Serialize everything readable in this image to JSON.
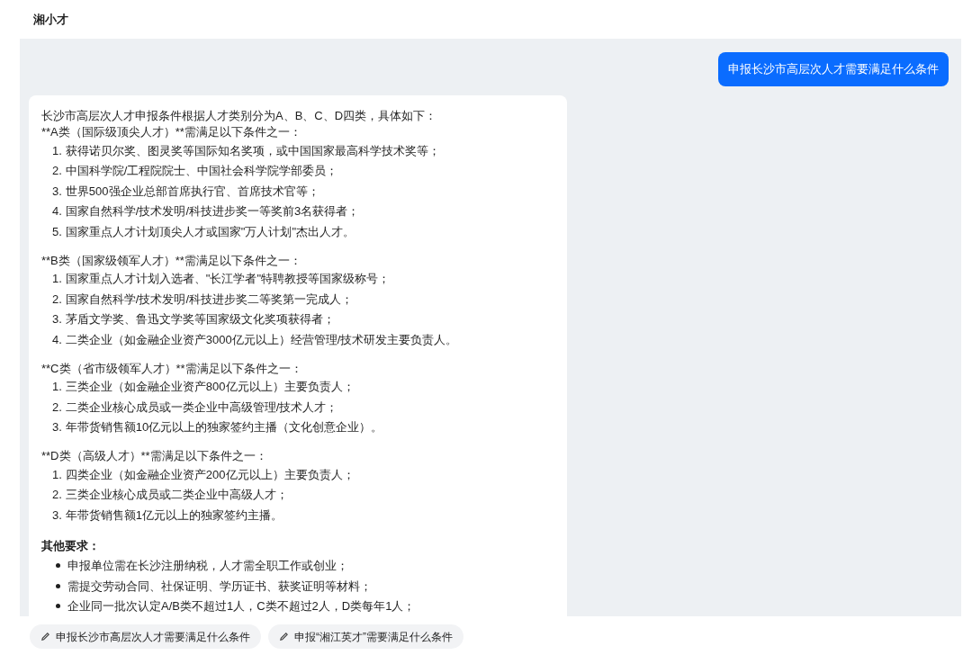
{
  "app_title": "湘小才",
  "user_message": "申报长沙市高层次人才需要满足什么条件",
  "answer": {
    "intro": "长沙市高层次人才申报条件根据人才类别分为A、B、C、D四类，具体如下：",
    "sections": [
      {
        "kind": "numbered",
        "heading": "**A类（国际级顶尖人才）**需满足以下条件之一：",
        "items": [
          {
            "number": "1.",
            "text": "获得诺贝尔奖、图灵奖等国际知名奖项，或中国国家最高科学技术奖等；"
          },
          {
            "number": "2.",
            "text": "中国科学院/工程院院士、中国社会科学院学部委员；"
          },
          {
            "number": "3.",
            "text": "世界500强企业总部首席执行官、首席技术官等；"
          },
          {
            "number": "4.",
            "text": "国家自然科学/技术发明/科技进步奖一等奖前3名获得者；"
          },
          {
            "number": "5.",
            "text": "国家重点人才计划顶尖人才或国家\"万人计划\"杰出人才。"
          }
        ]
      },
      {
        "kind": "numbered",
        "heading": "**B类（国家级领军人才）**需满足以下条件之一：",
        "items": [
          {
            "number": "1.",
            "text": "国家重点人才计划入选者、\"长江学者\"特聘教授等国家级称号；"
          },
          {
            "number": "2.",
            "text": "国家自然科学/技术发明/科技进步奖二等奖第一完成人；"
          },
          {
            "number": "3.",
            "text": "茅盾文学奖、鲁迅文学奖等国家级文化奖项获得者；"
          },
          {
            "number": "4.",
            "text": "二类企业（如金融企业资产3000亿元以上）经营管理/技术研发主要负责人。"
          }
        ]
      },
      {
        "kind": "numbered",
        "heading": "**C类（省市级领军人才）**需满足以下条件之一：",
        "items": [
          {
            "number": "1.",
            "text": "三类企业（如金融企业资产800亿元以上）主要负责人；"
          },
          {
            "number": "2.",
            "text": "二类企业核心成员或一类企业中高级管理/技术人才；"
          },
          {
            "number": "3.",
            "text": "年带货销售额10亿元以上的独家签约主播（文化创意企业）。"
          }
        ]
      },
      {
        "kind": "numbered",
        "heading": "**D类（高级人才）**需满足以下条件之一：",
        "items": [
          {
            "number": "1.",
            "text": "四类企业（如金融企业资产200亿元以上）主要负责人；"
          },
          {
            "number": "2.",
            "text": "三类企业核心成员或二类企业中高级人才；"
          },
          {
            "number": "3.",
            "text": "年带货销售额1亿元以上的独家签约主播。"
          }
        ]
      },
      {
        "kind": "bulleted",
        "heading": "其他要求：",
        "items": [
          {
            "text": "申报单位需在长沙注册纳税，人才需全职工作或创业；"
          },
          {
            "text": "需提交劳动合同、社保证明、学历证书、获奖证明等材料；"
          },
          {
            "text": "企业同一批次认定A/B类不超过1人，C类不超过2人，D类每年1人；"
          }
        ]
      }
    ]
  },
  "suggestions": [
    "申报长沙市高层次人才需要满足什么条件",
    "申报“湘江英才”需要满足什么条件"
  ]
}
